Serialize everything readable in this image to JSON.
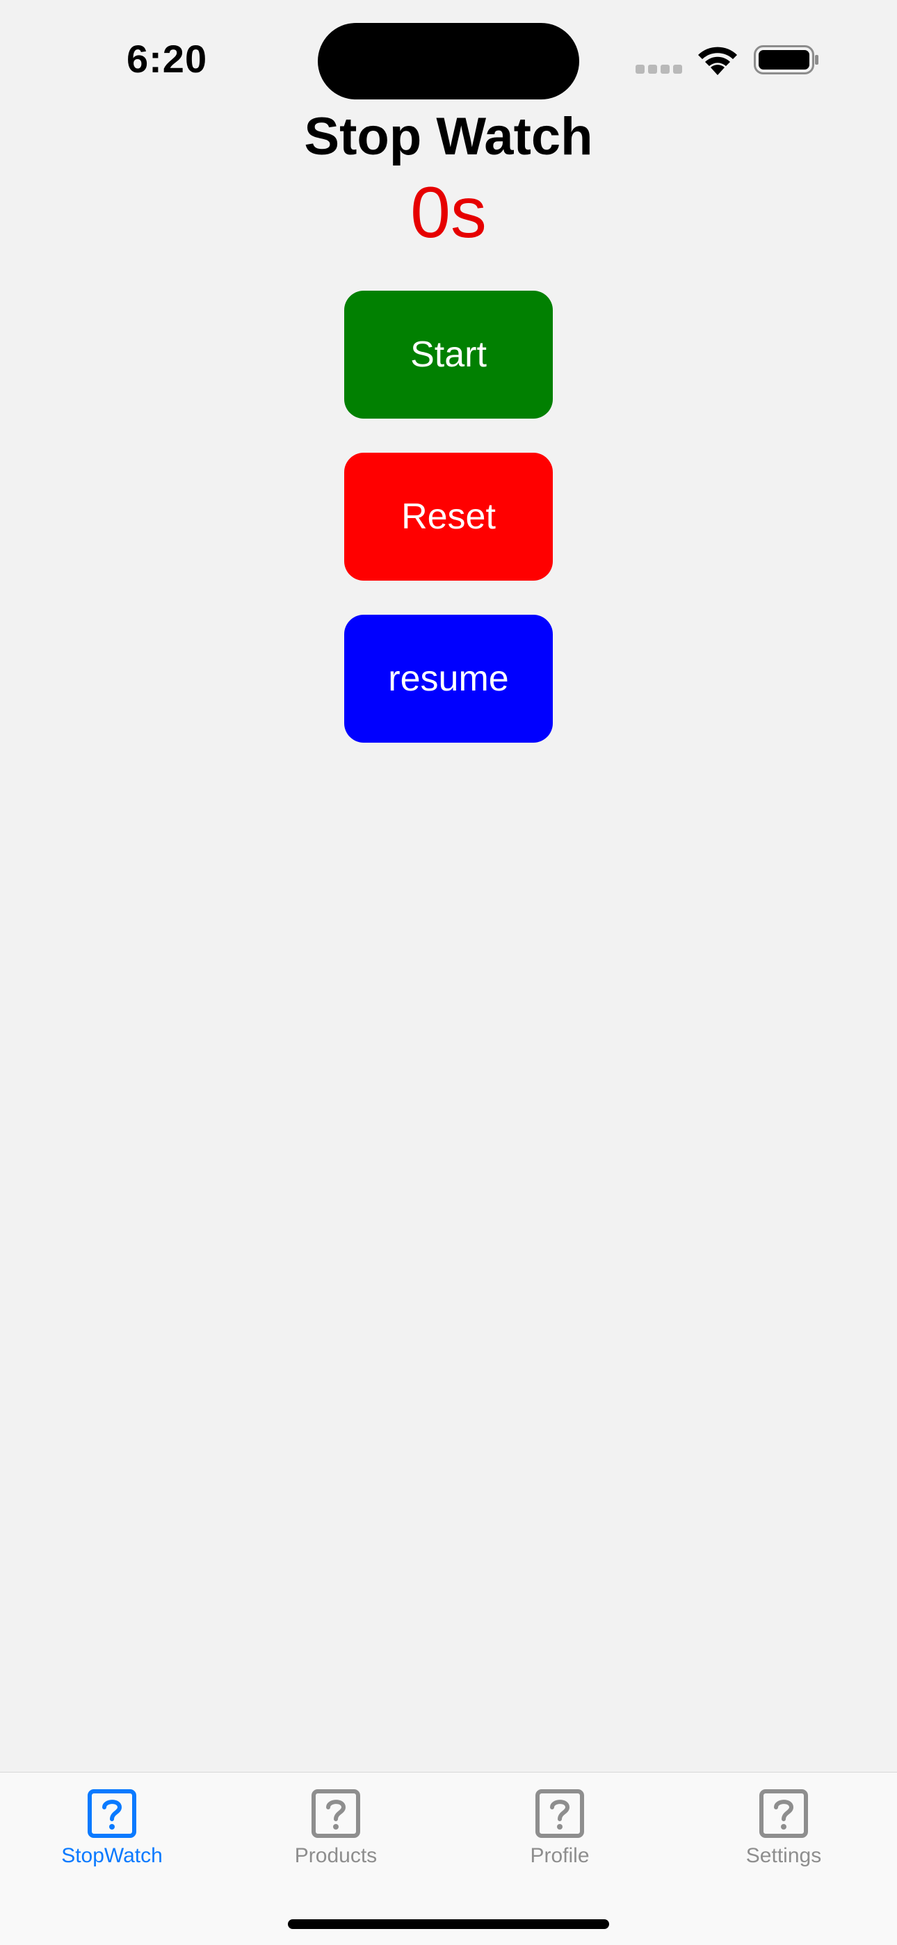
{
  "status_bar": {
    "time": "6:20",
    "icons": [
      "signal-icon",
      "wifi-icon",
      "battery-icon"
    ]
  },
  "page": {
    "title": "Stop Watch",
    "timer": "0s",
    "timer_color": "#e60000"
  },
  "buttons": {
    "start": {
      "label": "Start",
      "color": "#018001"
    },
    "reset": {
      "label": "Reset",
      "color": "#ff0000"
    },
    "resume": {
      "label": "resume",
      "color": "#0000ff"
    }
  },
  "tab_bar": {
    "active_color": "#0a7aff",
    "inactive_color": "#8e8e8e",
    "items": [
      {
        "label": "StopWatch",
        "icon": "question-square-icon",
        "active": true
      },
      {
        "label": "Products",
        "icon": "question-square-icon",
        "active": false
      },
      {
        "label": "Profile",
        "icon": "question-square-icon",
        "active": false
      },
      {
        "label": "Settings",
        "icon": "question-square-icon",
        "active": false
      }
    ]
  }
}
